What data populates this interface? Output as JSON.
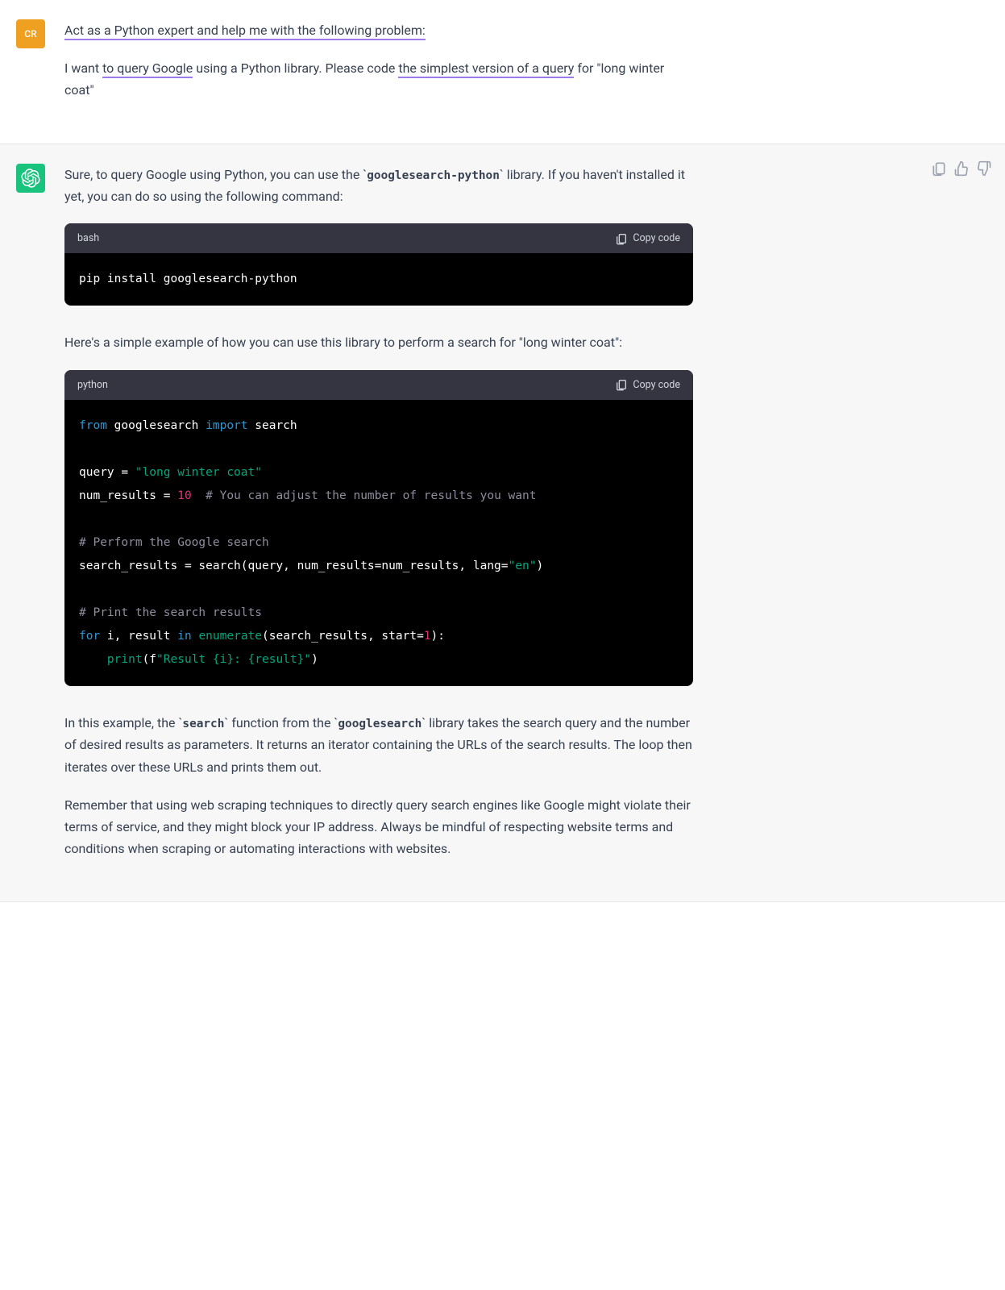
{
  "user": {
    "initials": "CR",
    "prompt": {
      "line1_prefix": "Act as a Python expert and help me with the following problem:",
      "para2_pre": "I want ",
      "para2_u1": "to query Google",
      "para2_mid": " using a Python library. Please code ",
      "para2_u2": "the simplest version of a query",
      "para2_post": " for \"long winter coat\""
    }
  },
  "assistant": {
    "p1_pre": "Sure, to query Google using Python, you can use the ",
    "p1_code": "googlesearch-python",
    "p1_post": " library. If you haven't installed it yet, you can do so using the following command:",
    "code1": {
      "lang": "bash",
      "copy": "Copy code",
      "line": "pip install googlesearch-python"
    },
    "p2": "Here's a simple example of how you can use this library to perform a search for \"long winter coat\":",
    "code2": {
      "lang": "python",
      "copy": "Copy code",
      "l1_from": "from",
      "l1_mod": " googlesearch ",
      "l1_import": "import",
      "l1_name": " search",
      "l3_pre": "query = ",
      "l3_str": "\"long winter coat\"",
      "l4_pre": "num_results = ",
      "l4_num": "10",
      "l4_cmt": "  # You can adjust the number of results you want",
      "l6_cmt": "# Perform the Google search",
      "l7_pre": "search_results = search(query, num_results=num_results, lang=",
      "l7_str": "\"en\"",
      "l7_post": ")",
      "l9_cmt": "# Print the search results",
      "l10_for": "for",
      "l10_mid": " i, result ",
      "l10_in": "in",
      "l10_sp": " ",
      "l10_enum": "enumerate",
      "l10_args_pre": "(search_results, start=",
      "l10_num": "1",
      "l10_args_post": "):",
      "l11_indent": "    ",
      "l11_print": "print",
      "l11_open": "(f",
      "l11_str": "\"Result {i}: {result}\"",
      "l11_close": ")"
    },
    "p3_pre": "In this example, the ",
    "p3_code1": "search",
    "p3_mid": " function from the ",
    "p3_code2": "googlesearch",
    "p3_post": " library takes the search query and the number of desired results as parameters. It returns an iterator containing the URLs of the search results. The loop then iterates over these URLs and prints them out.",
    "p4": "Remember that using web scraping techniques to directly query search engines like Google might violate their terms of service, and they might block your IP address. Always be mindful of respecting website terms and conditions when scraping or automating interactions with websites."
  }
}
